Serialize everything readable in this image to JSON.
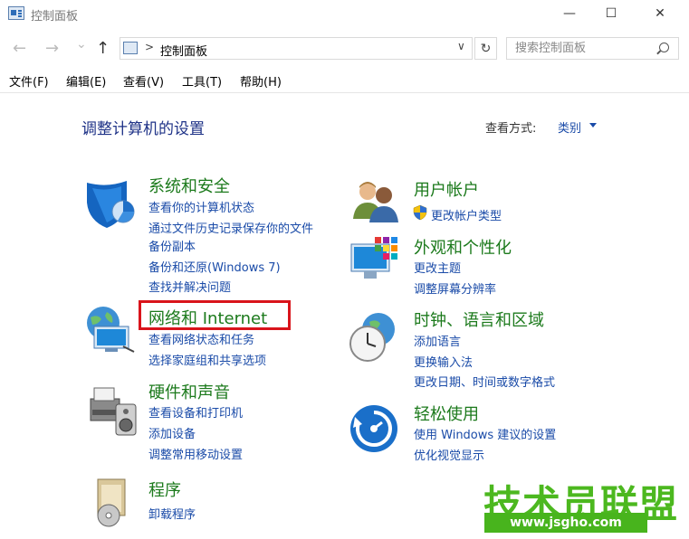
{
  "window": {
    "title": "控制面板",
    "minimize": "—",
    "maximize": "☐",
    "close": "✕"
  },
  "nav": {
    "back": "←",
    "forward": "→",
    "recent": "⌄",
    "up": "↑",
    "refresh": "↻"
  },
  "address": {
    "separator": ">",
    "path": "控制面板",
    "dropdown": "∨"
  },
  "search": {
    "placeholder": "搜索控制面板"
  },
  "menu": {
    "file": "文件(F)",
    "edit": "编辑(E)",
    "view": "查看(V)",
    "tools": "工具(T)",
    "help": "帮助(H)"
  },
  "content": {
    "title": "调整计算机的设置",
    "viewby_label": "查看方式:",
    "viewby_value": "类别"
  },
  "categories": {
    "system": {
      "title": "系统和安全",
      "links": [
        "查看你的计算机状态",
        "通过文件历史记录保存你的文件",
        "备份副本",
        "备份和还原(Windows 7)",
        "查找并解决问题"
      ]
    },
    "network": {
      "title": "网络和 Internet",
      "links": [
        "查看网络状态和任务",
        "选择家庭组和共享选项"
      ]
    },
    "hardware": {
      "title": "硬件和声音",
      "links": [
        "查看设备和打印机",
        "添加设备",
        "调整常用移动设置"
      ]
    },
    "programs": {
      "title": "程序",
      "links": [
        "卸载程序"
      ]
    },
    "users": {
      "title": "用户帐户",
      "links": [
        "更改帐户类型"
      ]
    },
    "appearance": {
      "title": "外观和个性化",
      "links": [
        "更改主题",
        "调整屏幕分辨率"
      ]
    },
    "clock": {
      "title": "时钟、语言和区域",
      "links": [
        "添加语言",
        "更换输入法",
        "更改日期、时间或数字格式"
      ]
    },
    "ease": {
      "title": "轻松使用",
      "links": [
        "使用 Windows 建议的设置",
        "优化视觉显示"
      ]
    }
  },
  "watermark": {
    "main": "技术员联盟",
    "sub": "www.jsgho.com"
  },
  "colors": {
    "link": "#1a4ba8",
    "category": "#1c7a1c",
    "title": "#1e3287",
    "highlight": "#d9141b",
    "watermark": "#4cb81f"
  }
}
